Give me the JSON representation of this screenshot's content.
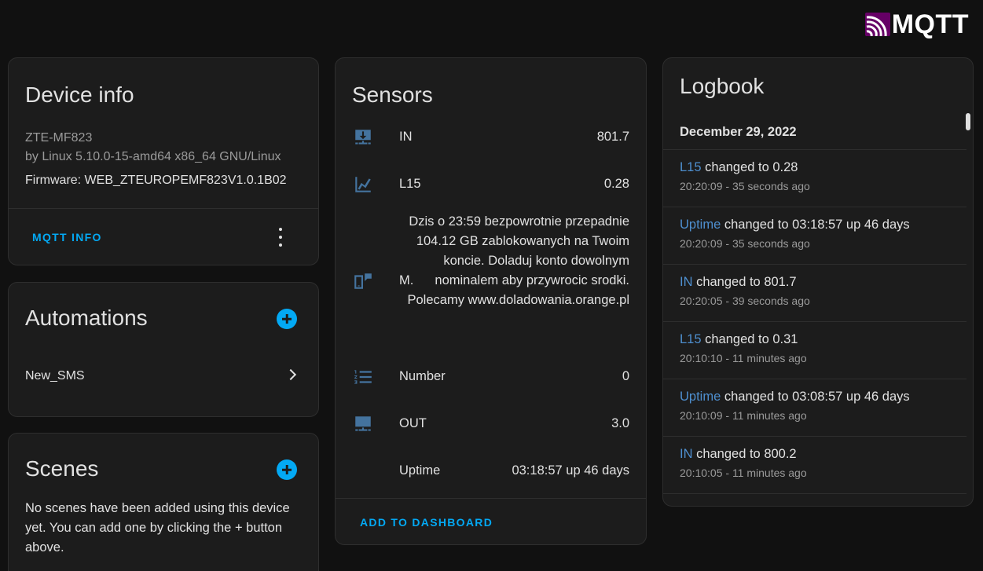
{
  "logo": {
    "text": "MQTT",
    "color": "#660066"
  },
  "device_info": {
    "title": "Device info",
    "model": "ZTE-MF823",
    "manufacturer": "by Linux 5.10.0-15-amd64 x86_64 GNU/Linux",
    "firmware": "Firmware: WEB_ZTEUROPEMF823V1.0.1B02",
    "mqtt_info_label": "MQTT INFO"
  },
  "automations": {
    "title": "Automations",
    "items": [
      {
        "label": "New_SMS"
      }
    ]
  },
  "scenes": {
    "title": "Scenes",
    "description": "No scenes have been added using this device yet. You can add one by clicking the + button above."
  },
  "sensors": {
    "title": "Sensors",
    "items": [
      {
        "icon": "download-network-icon",
        "name": "IN",
        "value": "801.7"
      },
      {
        "icon": "chart-areaspline-icon",
        "name": "L15",
        "value": "0.28"
      },
      {
        "icon": "message-phone-icon",
        "name": "M.",
        "value": "Dzis o 23:59 bezpowrotnie przepadnie 104.12 GB zablokowanych na Twoim koncie. Doladuj konto dowolnym nominalem aby przywrocic srodki. Polecamy www.doladowania.orange.pl"
      },
      {
        "icon": "numbered-list-icon",
        "name": "Number",
        "value": "0"
      },
      {
        "icon": "upload-network-icon",
        "name": "OUT",
        "value": "3.0"
      },
      {
        "icon": "",
        "name": "Uptime",
        "value": "03:18:57 up 46 days"
      }
    ],
    "add_to_dashboard_label": "ADD TO DASHBOARD"
  },
  "logbook": {
    "title": "Logbook",
    "date": "December 29, 2022",
    "entries": [
      {
        "entity": "L15",
        "message": " changed to 0.28",
        "time": "20:20:09 - 35 seconds ago"
      },
      {
        "entity": "Uptime",
        "message": " changed to 03:18:57 up 46 days",
        "time": "20:20:09 - 35 seconds ago"
      },
      {
        "entity": "IN",
        "message": " changed to 801.7",
        "time": "20:20:05 - 39 seconds ago"
      },
      {
        "entity": "L15",
        "message": " changed to 0.31",
        "time": "20:10:10 - 11 minutes ago"
      },
      {
        "entity": "Uptime",
        "message": " changed to 03:08:57 up 46 days",
        "time": "20:10:09 - 11 minutes ago"
      },
      {
        "entity": "IN",
        "message": " changed to 800.2",
        "time": "20:10:05 - 11 minutes ago"
      }
    ]
  },
  "colors": {
    "background": "#111111",
    "card": "#1c1c1c",
    "accent": "#03a9f4",
    "entity_link": "#4e8fcf",
    "icon": "#44739e"
  }
}
